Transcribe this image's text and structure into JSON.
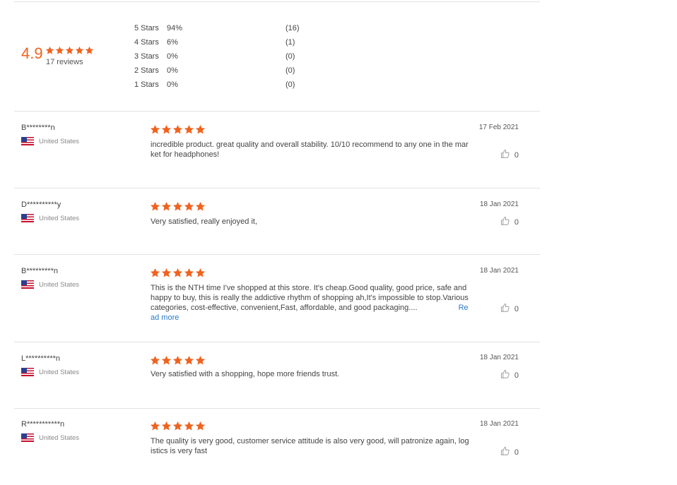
{
  "summary": {
    "rating": "4.9",
    "rating_stars": 5,
    "reviews_label": "17 reviews",
    "distribution": [
      {
        "label": "5 Stars",
        "percent": "94%",
        "count": "(16)"
      },
      {
        "label": "4 Stars",
        "percent": "6%",
        "count": "(1)"
      },
      {
        "label": "3 Stars",
        "percent": "0%",
        "count": "(0)"
      },
      {
        "label": "2 Stars",
        "percent": "0%",
        "count": "(0)"
      },
      {
        "label": "1 Stars",
        "percent": "0%",
        "count": "(0)"
      }
    ]
  },
  "colors": {
    "star": "#f0621e",
    "accent_link": "#2a7bc8"
  },
  "reviews": [
    {
      "reviewer": "B********n",
      "country": "United States",
      "stars": 5,
      "date": "17 Feb 2021",
      "text": "incredible product. great quality and overall stability. 10/10 recommend to any one in the market for headphones!",
      "read_more": "",
      "likes": "0"
    },
    {
      "reviewer": "D**********y",
      "country": "United States",
      "stars": 5,
      "date": "18 Jan 2021",
      "text": "Very satisfied, really enjoyed it,",
      "read_more": "",
      "likes": "0"
    },
    {
      "reviewer": "B*********n",
      "country": "United States",
      "stars": 5,
      "date": "18 Jan 2021",
      "text": "This is the NTH time I've shopped at this store. It's cheap.Good quality, good price, safe and happy to buy, this is really the addictive rhythm of shopping ah,It's impossible to stop.Various categories, cost-effective, convenient,Fast, affordable, and good packaging....",
      "read_more": "Read more",
      "likes": "0"
    },
    {
      "reviewer": "L**********n",
      "country": "United States",
      "stars": 5,
      "date": "18 Jan 2021",
      "text": "Very satisfied with a shopping, hope more friends trust.",
      "read_more": "",
      "likes": "0"
    },
    {
      "reviewer": "R***********n",
      "country": "United States",
      "stars": 5,
      "date": "18 Jan 2021",
      "text": "The quality is very good, customer service attitude is also very good, will patronize again, logistics is very fast",
      "read_more": "",
      "likes": "0"
    }
  ]
}
